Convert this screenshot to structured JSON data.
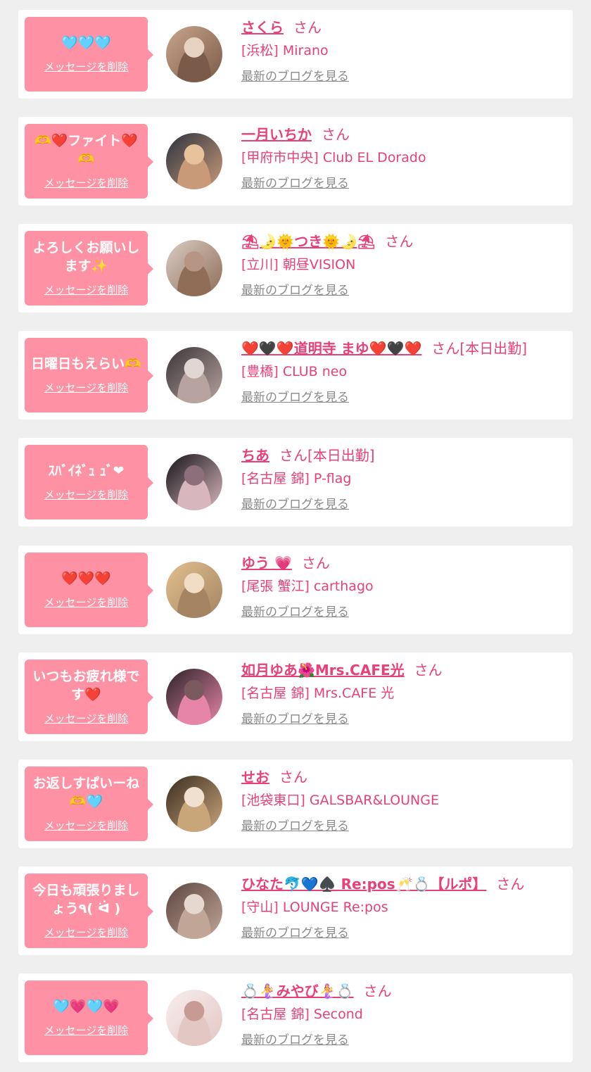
{
  "colors": {
    "background": "#efeff0",
    "card": "#ffffff",
    "bubble": "#ff91a4",
    "accent": "#e8407a",
    "muted": "#8a8a8a"
  },
  "delete_label": "メッセージを削除",
  "blog_label": "最新のブログを見る",
  "san_label": "さん",
  "messages": [
    {
      "message": "🩵🩵🩵",
      "name": "さくら",
      "badge": "",
      "shop": "[浜松] Mirano",
      "avatar_icon": "avatar-photo-icon",
      "avatar_colors": [
        "#c9a58c",
        "#7a5a48",
        "#e8d3c2"
      ]
    },
    {
      "message": "🫶❤️ファイト❤️🫶",
      "name": "一月いちか",
      "badge": "",
      "shop": "[甲府市中央] Club EL Dorado",
      "avatar_icon": "avatar-photo-icon",
      "avatar_colors": [
        "#2b3240",
        "#c99a78",
        "#e7c29a"
      ]
    },
    {
      "message": "よろしくお願いします✨",
      "name": "⛱🌛🌞つき🌞🌛⛱",
      "badge": "",
      "shop": "[立川] 朝昼VISION",
      "avatar_icon": "avatar-photo-icon",
      "avatar_colors": [
        "#d8ccc4",
        "#8f6d57",
        "#b69584"
      ]
    },
    {
      "message": "日曜日もえらい🫶",
      "name": "❤️🖤❤️道明寺 まゆ❤️🖤❤️",
      "badge": "[本日出勤]",
      "shop": "[豊橋] CLUB neo",
      "avatar_icon": "avatar-photo-icon",
      "avatar_colors": [
        "#3a3438",
        "#b7a3a0",
        "#e2d6d4"
      ]
    },
    {
      "message": "ｽﾊﾞｲﾈﾞｭ ｭﾞ❤",
      "name": "ちあ",
      "badge": "[本日出勤]",
      "shop": "[名古屋 錦] P-flag",
      "avatar_icon": "avatar-photo-icon",
      "avatar_colors": [
        "#151318",
        "#d7b7bd",
        "#8c6f7a"
      ]
    },
    {
      "message": "❤️❤️❤️",
      "name": "ゆう 💗",
      "badge": "",
      "shop": "[尾張 蟹江] carthago",
      "avatar_icon": "avatar-photo-icon",
      "avatar_colors": [
        "#e2c08f",
        "#a48462",
        "#f1ddc6"
      ]
    },
    {
      "message": "いつもお疲れ様です❤️",
      "name": "如月ゆあ🌺Mrs.CAFE光",
      "badge": "",
      "shop": "[名古屋 錦] Mrs.CAFE 光",
      "avatar_icon": "avatar-photo-icon",
      "avatar_colors": [
        "#2b2226",
        "#e685a8",
        "#7a5a5f"
      ]
    },
    {
      "message": "お返しすぱいーね🫶🩵",
      "name": "せお",
      "badge": "",
      "shop": "[池袋東口] GALSBAR&LOUNGE",
      "avatar_icon": "avatar-photo-icon",
      "avatar_colors": [
        "#3a2c20",
        "#c9a57a",
        "#efe0cf"
      ]
    },
    {
      "message": "今日も頑張りましょう٩( ᐛ )",
      "name": "ひなた🐬💙♠️ Re:pos🥂💍【ルポ】",
      "badge": "",
      "shop": "[守山] LOUNGE Re:pos",
      "avatar_icon": "avatar-photo-icon",
      "avatar_colors": [
        "#5b4640",
        "#c1a597",
        "#e6d8cf"
      ]
    },
    {
      "message": "🩵💗🩵💗",
      "name": "💍🧜‍♀️みやび🧜‍♀️💍",
      "badge": "",
      "shop": "[名古屋 錦] Second",
      "avatar_icon": "avatar-photo-icon",
      "avatar_colors": [
        "#f7eeee",
        "#e3c7c3",
        "#c79b93"
      ]
    }
  ]
}
